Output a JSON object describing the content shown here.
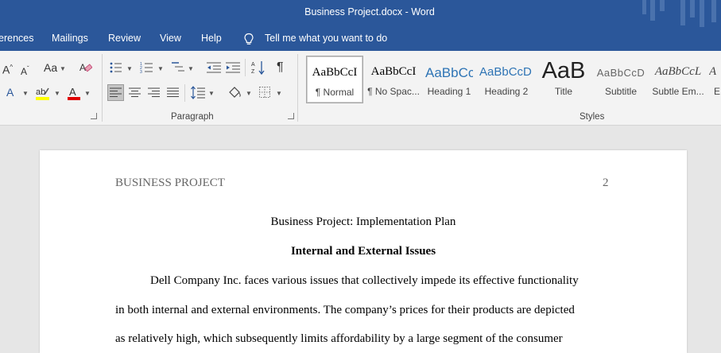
{
  "window": {
    "title": "Business Project.docx  -  Word"
  },
  "menu": {
    "items": [
      "erences",
      "Mailings",
      "Review",
      "View",
      "Help"
    ],
    "tell_me": "Tell me what you want to do"
  },
  "ribbon": {
    "font": {
      "change_case": "Aa"
    },
    "paragraph": {
      "label": "Paragraph"
    },
    "styles": {
      "label": "Styles",
      "items": [
        {
          "preview": "AaBbCcI",
          "name": "¶ Normal"
        },
        {
          "preview": "AaBbCcI",
          "name": "¶ No Spac..."
        },
        {
          "preview": "AaBbCc",
          "name": "Heading 1"
        },
        {
          "preview": "AaBbCcD",
          "name": "Heading 2"
        },
        {
          "preview": "AaB",
          "name": "Title"
        },
        {
          "preview": "AaBbCcD",
          "name": "Subtitle"
        },
        {
          "preview": "AaBbCcL",
          "name": "Subtle Em..."
        },
        {
          "preview": "A",
          "name": "E"
        }
      ]
    },
    "colors": {
      "highlight": "#ffff00",
      "font_color": "#e00000"
    }
  },
  "document": {
    "running_head": "BUSINESS PROJECT",
    "page_number": "2",
    "title": "Business Project: Implementation Plan",
    "heading": "Internal and External Issues",
    "lines": [
      "Dell Company Inc. faces various issues that collectively impede its effective functionality",
      "in both internal and external environments. The company’s prices for their products are depicted",
      "as relatively high, which subsequently limits affordability by a large segment of the consumer"
    ]
  }
}
